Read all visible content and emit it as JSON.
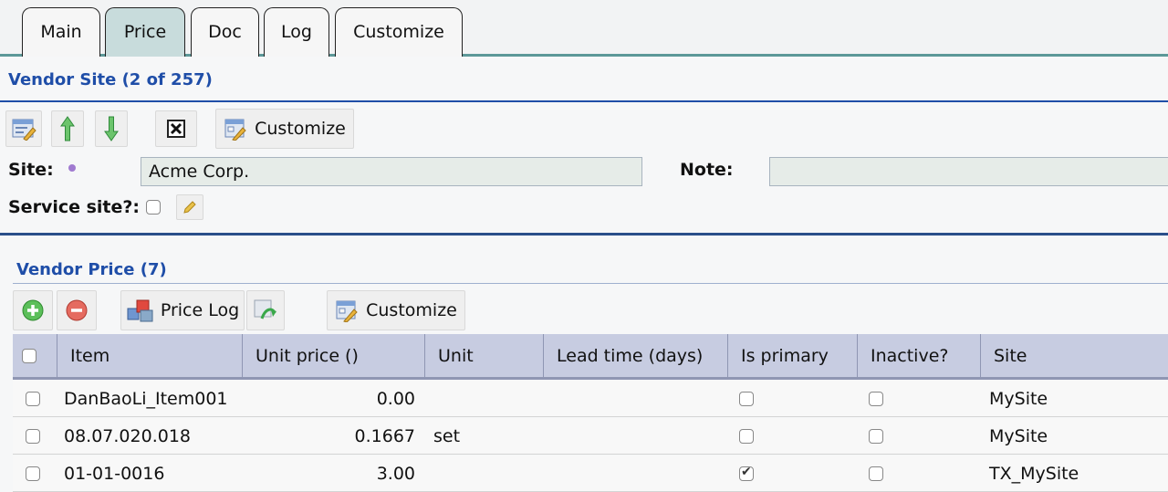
{
  "tabs": [
    {
      "label": "Main",
      "active": false
    },
    {
      "label": "Price",
      "active": true
    },
    {
      "label": "Doc",
      "active": false
    },
    {
      "label": "Log",
      "active": false
    },
    {
      "label": "Customize",
      "active": false
    }
  ],
  "vendor_site": {
    "title": "Vendor Site (2 of 257)",
    "toolbar": {
      "customize_label": "Customize"
    },
    "site_label": "Site:",
    "site_value": "Acme Corp.",
    "note_label": "Note:",
    "note_value": "",
    "service_site_label": "Service site?:",
    "service_site_checked": false
  },
  "vendor_price": {
    "title": "Vendor Price (7)",
    "toolbar": {
      "price_log_label": "Price Log",
      "customize_label": "Customize"
    },
    "columns": [
      "Item",
      "Unit price ()",
      "Unit",
      "Lead time (days)",
      "Is primary",
      "Inactive?",
      "Site"
    ],
    "rows": [
      {
        "item": "DanBaoLi_Item001",
        "unit_price": "0.00",
        "unit": "",
        "lead_time": "",
        "is_primary": false,
        "inactive": false,
        "site": "MySite"
      },
      {
        "item": "08.07.020.018",
        "unit_price": "0.1667",
        "unit": "set",
        "lead_time": "",
        "is_primary": false,
        "inactive": false,
        "site": "MySite"
      },
      {
        "item": "01-01-0016",
        "unit_price": "3.00",
        "unit": "",
        "lead_time": "",
        "is_primary": true,
        "inactive": false,
        "site": "TX_MySite"
      }
    ]
  },
  "colors": {
    "accent": "#1f4ea8",
    "tab_active": "#c8dcdc",
    "grid_header": "#c7cce1"
  }
}
